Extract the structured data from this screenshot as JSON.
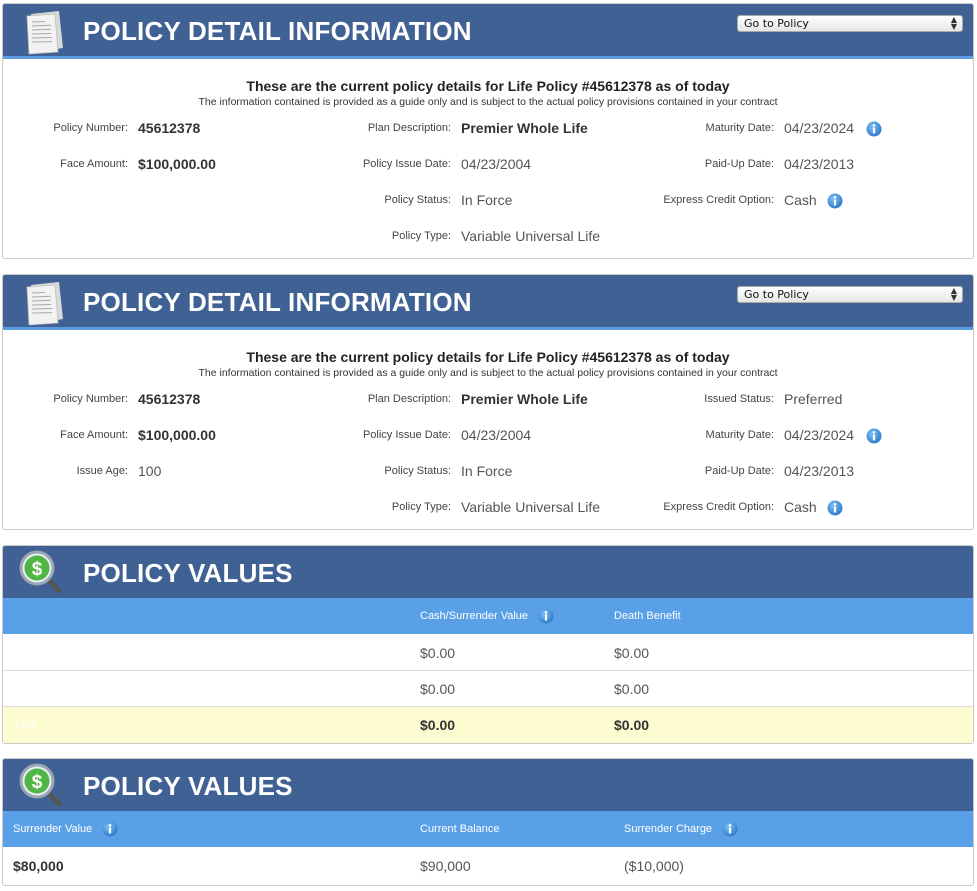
{
  "colors": {
    "header_bg": "#3f6193",
    "header_accent": "#5b9de0",
    "table_header_bg": "#5aa0e6",
    "total_row_bg": "#fdfbd0",
    "info_icon": "#3a88d8"
  },
  "panel1": {
    "title": "POLICY DETAIL INFORMATION",
    "icon": "document-icon",
    "goto_select": "Go to Policy",
    "intro_main": "These are the current policy details for Life Policy #45612378 as of today",
    "intro_sub": "The information contained is provided as a guide only and is subject to the actual policy provisions contained in your contract",
    "fields": {
      "policy_number_label": "Policy Number:",
      "policy_number": "45612378",
      "face_amount_label": "Face Amount:",
      "face_amount": "$100,000.00",
      "plan_description_label": "Plan Description:",
      "plan_description": "Premier Whole Life",
      "policy_issue_date_label": "Policy Issue Date:",
      "policy_issue_date": "04/23/2004",
      "policy_status_label": "Policy Status:",
      "policy_status": "In Force",
      "policy_type_label": "Policy Type:",
      "policy_type": "Variable Universal Life",
      "maturity_date_label": "Maturity Date:",
      "maturity_date": "04/23/2024",
      "paid_up_date_label": "Paid-Up Date:",
      "paid_up_date": "04/23/2013",
      "express_credit_label": "Express Credit Option:",
      "express_credit": "Cash"
    }
  },
  "panel2": {
    "title": "POLICY DETAIL INFORMATION",
    "icon": "document-icon",
    "goto_select": "Go to Policy",
    "intro_main": "These are the current policy details for Life Policy #45612378 as of today",
    "intro_sub": "The information contained is provided as a guide only and is subject to the actual policy provisions contained in your contract",
    "fields": {
      "policy_number_label": "Policy Number:",
      "policy_number": "45612378",
      "face_amount_label": "Face Amount:",
      "face_amount": "$100,000.00",
      "issue_age_label": "Issue Age:",
      "issue_age": "100",
      "plan_description_label": "Plan Description:",
      "plan_description": "Premier Whole Life",
      "policy_issue_date_label": "Policy Issue Date:",
      "policy_issue_date": "04/23/2004",
      "policy_status_label": "Policy Status:",
      "policy_status": "In Force",
      "policy_type_label": "Policy Type:",
      "policy_type": "Variable Universal Life",
      "issued_status_label": "Issued Status:",
      "issued_status": "Preferred",
      "maturity_date_label": "Maturity Date:",
      "maturity_date": "04/23/2024",
      "paid_up_date_label": "Paid-Up Date:",
      "paid_up_date": "04/23/2013",
      "express_credit_label": "Express Credit Option:",
      "express_credit": "Cash"
    }
  },
  "panel3": {
    "title": "POLICY VALUES",
    "icon": "dollar-magnifier-icon",
    "columns": [
      "",
      "Cash/Surrender Value",
      "Death Benefit"
    ],
    "rows": [
      {
        "label": "",
        "cash": "$0.00",
        "death": "$0.00"
      },
      {
        "label": "",
        "cash": "$0.00",
        "death": "$0.00"
      }
    ],
    "total": {
      "label": "Total",
      "cash": "$0.00",
      "death": "$0.00"
    }
  },
  "panel4": {
    "title": "POLICY VALUES",
    "icon": "dollar-magnifier-icon",
    "columns": [
      "Surrender Value",
      "Current Balance",
      "Surrender Charge"
    ],
    "row": {
      "surrender_value": "$80,000",
      "current_balance": "$90,000",
      "surrender_charge": "($10,000)"
    }
  }
}
